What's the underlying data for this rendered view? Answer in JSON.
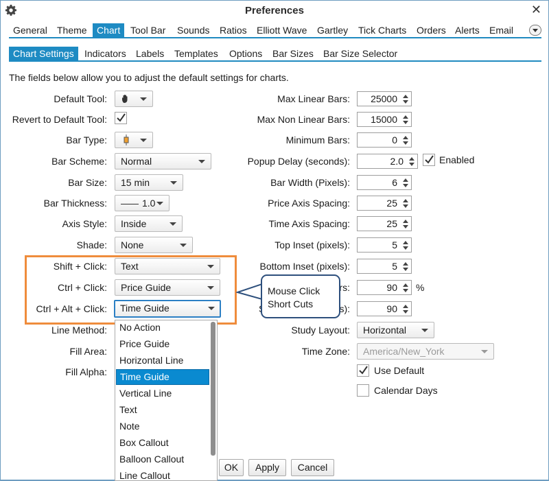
{
  "window": {
    "title": "Preferences"
  },
  "main_tabs": [
    "General",
    "Theme",
    "Chart",
    "Tool Bar",
    "Sounds",
    "Ratios",
    "Elliott Wave",
    "Gartley",
    "Tick Charts",
    "Orders",
    "Alerts",
    "Email"
  ],
  "sub_tabs": [
    "Chart Settings",
    "Indicators",
    "Labels",
    "Templates",
    "Options",
    "Bar Sizes",
    "Bar Size Selector"
  ],
  "intro_text": "The fields below allow you to adjust the default settings for charts.",
  "left": {
    "default_tool_label": "Default Tool:",
    "revert_label": "Revert to Default Tool:",
    "bar_type_label": "Bar Type:",
    "bar_scheme_label": "Bar Scheme:",
    "bar_scheme_value": "Normal",
    "bar_size_label": "Bar Size:",
    "bar_size_value": "15 min",
    "bar_thickness_label": "Bar Thickness:",
    "bar_thickness_value": "1.0",
    "axis_style_label": "Axis Style:",
    "axis_style_value": "Inside",
    "shade_label": "Shade:",
    "shade_value": "None",
    "shift_click_label": "Shift + Click:",
    "shift_click_value": "Text",
    "ctrl_click_label": "Ctrl + Click:",
    "ctrl_click_value": "Price Guide",
    "ctrl_alt_click_label": "Ctrl + Alt + Click:",
    "ctrl_alt_click_value": "Time Guide",
    "line_method_label": "Line Method:",
    "fill_area_label": "Fill Area:",
    "fill_alpha_label": "Fill Alpha:"
  },
  "right": {
    "max_linear_label": "Max Linear Bars:",
    "max_linear_value": "25000",
    "max_nonlinear_label": "Max Non Linear Bars:",
    "max_nonlinear_value": "15000",
    "min_bars_label": "Minimum Bars:",
    "min_bars_value": "0",
    "popup_delay_label": "Popup Delay (seconds):",
    "popup_delay_value": "2.0",
    "popup_enabled_label": "Enabled",
    "bar_width_label": "Bar Width (Pixels):",
    "bar_width_value": "6",
    "price_axis_label": "Price Axis Spacing:",
    "price_axis_value": "25",
    "time_axis_label": "Time Axis Spacing:",
    "time_axis_value": "25",
    "top_inset_label": "Top Inset (pixels):",
    "top_inset_value": "5",
    "bottom_inset_label": "Bottom Inset (pixels):",
    "bottom_inset_value": "5",
    "row_bars_label_fragment": "Bars:",
    "row_bars_value": "90",
    "row_bars_unit": "%",
    "row_pixels_label_prefix": "S",
    "row_pixels_label_fragment": "xels):",
    "row_pixels_value": "90",
    "study_layout_label": "Study Layout:",
    "study_layout_value": "Horizontal",
    "time_zone_label": "Time Zone:",
    "time_zone_value": "America/New_York",
    "use_default_label": "Use Default",
    "calendar_days_label": "Calendar Days"
  },
  "callout": {
    "line1": "Mouse Click",
    "line2": "Short Cuts"
  },
  "dropdown_items": [
    "No Action",
    "Price Guide",
    "Horizontal Line",
    "Time Guide",
    "Vertical Line",
    "Text",
    "Note",
    "Box Callout",
    "Balloon Callout",
    "Line Callout"
  ],
  "dropdown_selected_index": 3,
  "buttons": {
    "ok": "OK",
    "apply": "Apply",
    "cancel": "Cancel"
  },
  "checkboxes": {
    "revert_to_default": true,
    "popup_enabled": true,
    "use_default": true,
    "calendar_days": false
  },
  "colors": {
    "accent": "#1e8bc3",
    "highlight_box": "#ef8c3c",
    "callout_border": "#2d4f7c",
    "selected_item": "#0a8ad0"
  }
}
